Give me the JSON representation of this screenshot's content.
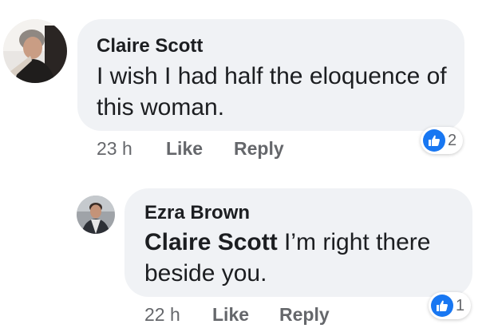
{
  "comments": [
    {
      "author": "Claire Scott",
      "text": "I wish I had half the eloquence of this woman.",
      "time": "23 h",
      "like_label": "Like",
      "reply_label": "Reply",
      "reaction_count": "2",
      "reaction_icon": "thumbs-up-icon"
    },
    {
      "author": "Ezra Brown",
      "mention": "Claire Scott",
      "text": " I’m right there beside you.",
      "time": "22 h",
      "like_label": "Like",
      "reply_label": "Reply",
      "reaction_count": "1",
      "reaction_icon": "thumbs-up-icon"
    }
  ],
  "colors": {
    "bubble": "#f0f2f5",
    "meta_text": "#65676b",
    "like_blue": "#1877f2"
  }
}
